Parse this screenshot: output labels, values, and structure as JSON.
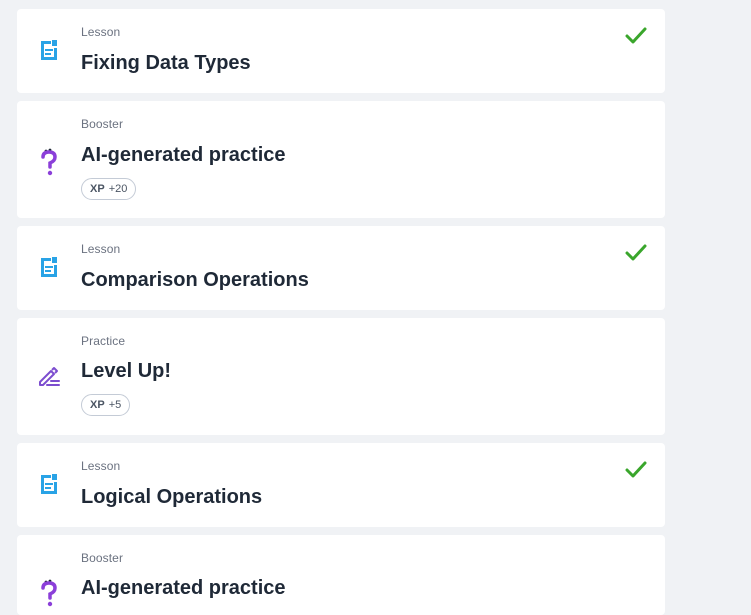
{
  "colors": {
    "background": "#f0f2f5",
    "card": "#ffffff",
    "lesson_icon": "#29a3e6",
    "booster_icon": "#8b3fd9",
    "practice_icon": "#7c4dcf",
    "check": "#3aa62c",
    "title": "#1f2937",
    "type_label": "#6b7280"
  },
  "items": [
    {
      "type": "Lesson",
      "title": "Fixing Data Types",
      "icon": "lesson-document-icon",
      "completed": true
    },
    {
      "type": "Booster",
      "title": "AI-generated practice",
      "icon": "booster-question-icon",
      "xp_label": "XP",
      "xp_value": "+20"
    },
    {
      "type": "Lesson",
      "title": "Comparison Operations",
      "icon": "lesson-document-icon",
      "completed": true
    },
    {
      "type": "Practice",
      "title": "Level Up!",
      "icon": "practice-pencil-icon",
      "xp_label": "XP",
      "xp_value": "+5"
    },
    {
      "type": "Lesson",
      "title": "Logical Operations",
      "icon": "lesson-document-icon",
      "completed": true
    },
    {
      "type": "Booster",
      "title": "AI-generated practice",
      "icon": "booster-question-icon"
    }
  ]
}
